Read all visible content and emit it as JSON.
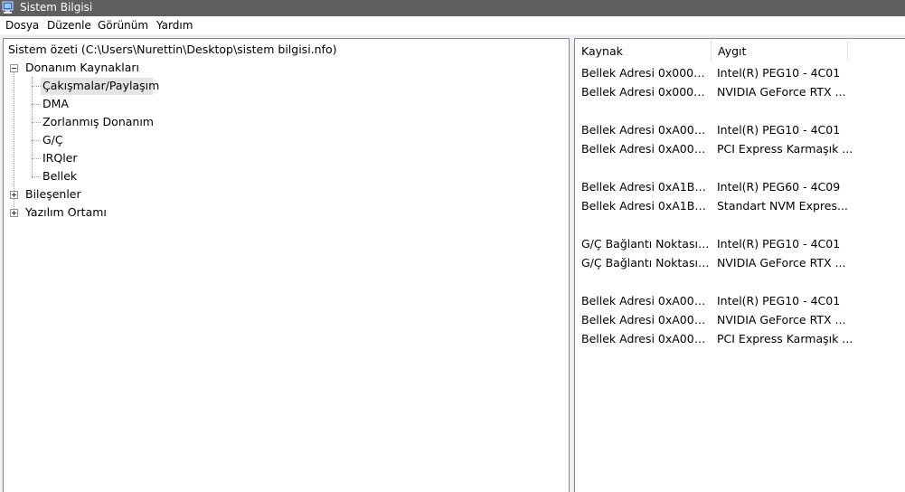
{
  "window": {
    "title": "Sistem Bilgisi",
    "icon": "system-information-icon"
  },
  "menu": {
    "items": [
      "Dosya",
      "Düzenle",
      "Görünüm",
      "Yardım"
    ]
  },
  "tree": {
    "root": "Sistem özeti (C:\\Users\\Nurettin\\Desktop\\sistem bilgisi.nfo)",
    "hardware": {
      "label": "Donanım Kaynakları",
      "expander_icon": "collapse-minus-icon",
      "children": [
        "Çakışmalar/Paylaşım",
        "DMA",
        "Zorlanmış Donanım",
        "G/Ç",
        "IRQler",
        "Bellek"
      ],
      "selected": "Çakışmalar/Paylaşım"
    },
    "components": {
      "label": "Bileşenler",
      "expander_icon": "expand-plus-icon"
    },
    "software": {
      "label": "Yazılım Ortamı",
      "expander_icon": "expand-plus-icon"
    }
  },
  "list": {
    "columns": [
      "Kaynak",
      "Aygıt"
    ],
    "rows": [
      [
        "Bellek Adresi 0x0000-0...",
        "Intel(R) PEG10 - 4C01"
      ],
      [
        "Bellek Adresi 0x0000-0...",
        "NVIDIA GeForce RTX ..."
      ],
      [
        "",
        ""
      ],
      [
        "Bellek Adresi 0xA0000-...",
        "Intel(R) PEG10 - 4C01"
      ],
      [
        "Bellek Adresi 0xA0000-...",
        "PCI Express Karmaşık ..."
      ],
      [
        "",
        ""
      ],
      [
        "Bellek Adresi 0xA1B00...",
        "Intel(R) PEG60 - 4C09"
      ],
      [
        "Bellek Adresi 0xA1B00...",
        "Standart NVM Expres..."
      ],
      [
        "",
        ""
      ],
      [
        "G/Ç Bağlantı Noktası 0...",
        "Intel(R) PEG10 - 4C01"
      ],
      [
        "G/Ç Bağlantı Noktası 0...",
        "NVIDIA GeForce RTX ..."
      ],
      [
        "",
        ""
      ],
      [
        "Bellek Adresi 0xA0000...",
        "Intel(R) PEG10 - 4C01"
      ],
      [
        "Bellek Adresi 0xA0000...",
        "NVIDIA GeForce RTX ..."
      ],
      [
        "Bellek Adresi 0xA0000...",
        "PCI Express Karmaşık ..."
      ]
    ]
  }
}
